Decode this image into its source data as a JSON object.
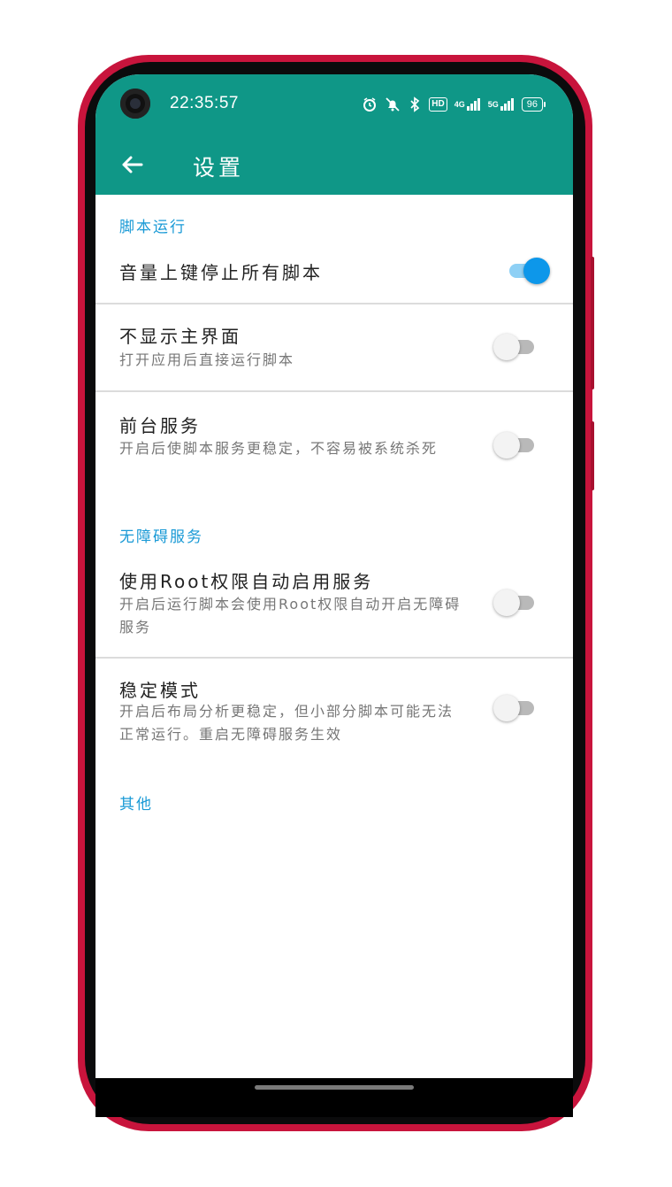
{
  "status_bar": {
    "time": "22:35:57",
    "hd_label": "HD",
    "network_4g": "4G",
    "network_5g": "5G",
    "battery": "96"
  },
  "app_bar": {
    "title": "设置"
  },
  "sections": [
    {
      "header": "脚本运行",
      "items": [
        {
          "title": "音量上键停止所有脚本",
          "summary": "",
          "checked": true
        },
        {
          "title": "不显示主界面",
          "summary": "打开应用后直接运行脚本",
          "checked": false
        },
        {
          "title": "前台服务",
          "summary": "开启后使脚本服务更稳定，不容易被系统杀死",
          "checked": false
        }
      ]
    },
    {
      "header": "无障碍服务",
      "items": [
        {
          "title": "使用Root权限自动启用服务",
          "summary": "开启后运行脚本会使用Root权限自动开启无障碍服务",
          "checked": false
        },
        {
          "title": "稳定模式",
          "summary": "开启后布局分析更稳定，但小部分脚本可能无法正常运行。重启无障碍服务生效",
          "checked": false
        }
      ]
    },
    {
      "header": "其他",
      "items": []
    }
  ],
  "colors": {
    "primary": "#0f9787",
    "accent": "#0d97ea",
    "section_header": "#1a9ad6"
  }
}
